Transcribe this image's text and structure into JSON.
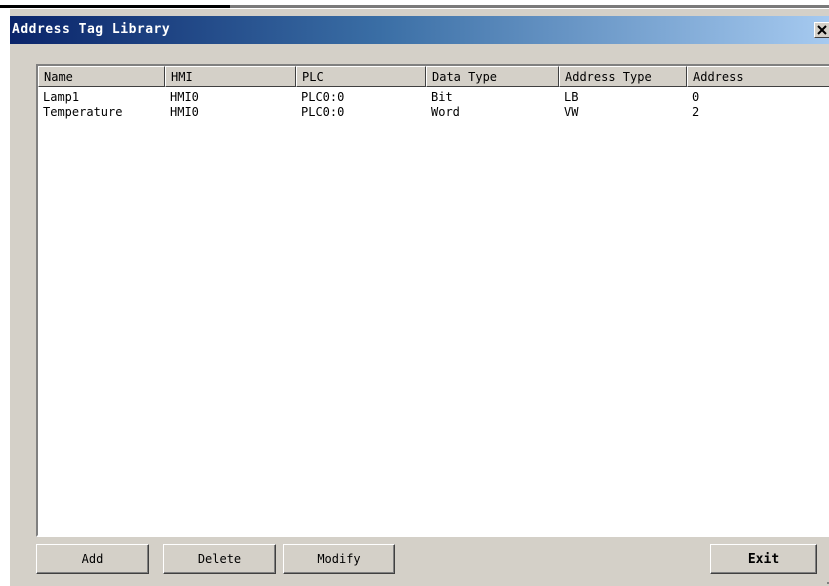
{
  "window": {
    "title": "Address Tag Library",
    "close_label": "×"
  },
  "table": {
    "columns": [
      "Name",
      "HMI",
      "PLC",
      "Data Type",
      "Address Type",
      "Address"
    ],
    "rows": [
      [
        "Lamp1",
        "HMI0",
        "PLC0:0",
        "Bit",
        "LB",
        "0"
      ],
      [
        "Temperature",
        "HMI0",
        "PLC0:0",
        "Word",
        "VW",
        "2"
      ]
    ]
  },
  "buttons": {
    "add": "Add",
    "delete": "Delete",
    "modify": "Modify",
    "exit": "Exit"
  },
  "colors": {
    "titlebar_start": "#0a246a",
    "titlebar_end": "#a6caf0",
    "face": "#d4d0c8"
  },
  "icons": {
    "close": "close-icon"
  }
}
